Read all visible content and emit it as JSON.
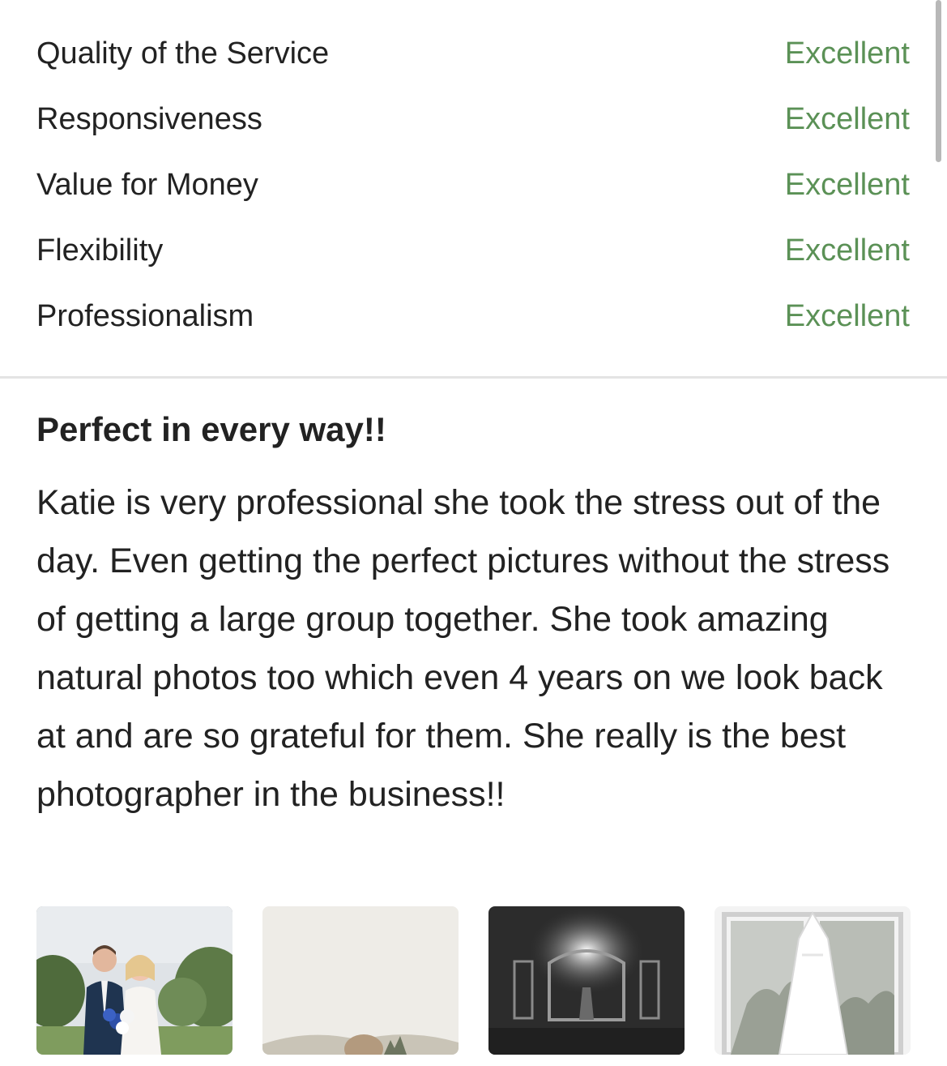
{
  "ratings": [
    {
      "label": "Quality of the Service",
      "value": "Excellent"
    },
    {
      "label": "Responsiveness",
      "value": "Excellent"
    },
    {
      "label": "Value for Money",
      "value": "Excellent"
    },
    {
      "label": "Flexibility",
      "value": "Excellent"
    },
    {
      "label": "Professionalism",
      "value": "Excellent"
    }
  ],
  "review": {
    "title": "Perfect in every way!!",
    "body": "Katie is very professional she took the stress out of the day. Even getting the perfect pictures without the stress of getting a large group together. She took amazing natural photos too which even 4 years on we look back at and are so grateful for them. She really is the best photographer in the business!!"
  },
  "colors": {
    "rating_value": "#5b9156",
    "text": "#222222",
    "divider": "#e4e4e4"
  }
}
